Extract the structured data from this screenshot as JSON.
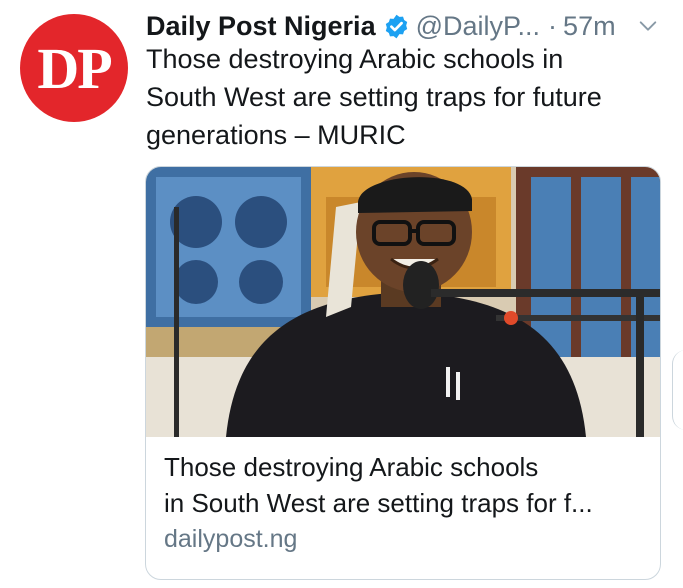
{
  "account": {
    "avatar_text": "DP",
    "name": "Daily Post Nigeria",
    "handle": "@DailyP...",
    "separator": "·",
    "time": "57m"
  },
  "tweet": {
    "text": "Those destroying Arabic schools in\nSouth West are setting traps for future\ngenerations – MURIC"
  },
  "card": {
    "title_line1": "Those destroying Arabic schools",
    "title_line2": "in South West are setting traps for f...",
    "domain": "dailypost.ng"
  },
  "icons": [
    "verified-badge-icon",
    "chevron-down-icon"
  ],
  "colors": {
    "brand_red": "#e3262b",
    "verified_blue": "#1da1f2",
    "secondary_text": "#657786"
  }
}
